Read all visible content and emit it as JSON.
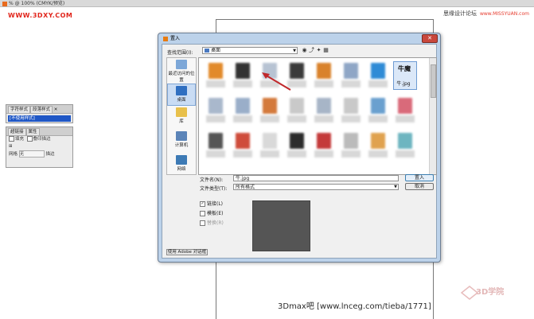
{
  "top_bar": {
    "title": "% @ 100% (CMYK/预览)"
  },
  "watermarks": {
    "left_site": "WWW.3DXY.COM",
    "right_site_cn": "思缘设计论坛",
    "right_site_en": "www.MISSYUAN.com",
    "bottom_text": "3Dmax吧  [www.lnceg.com/tieba/1771]",
    "bottom_logo": "3D学院"
  },
  "panel1": {
    "tabs": [
      "字符样式",
      "段落样式"
    ],
    "selected": "[不使用样式]"
  },
  "panel2": {
    "tabs": [
      "超链接",
      "属性"
    ],
    "row1": [
      "填充",
      "叠印描边"
    ],
    "row2_label": "网格",
    "row2_value": "无",
    "row2_button": "描边"
  },
  "dialog": {
    "title": "置入",
    "close_label": "✕",
    "lookin_label": "查找范围(I):",
    "lookin_value": "桌面",
    "toolbar_icons": [
      "back-icon",
      "up-folder-icon",
      "new-folder-icon",
      "view-menu-icon"
    ],
    "places": [
      {
        "label": "最近访问的位置",
        "icon": "recent-icon"
      },
      {
        "label": "桌面",
        "icon": "desktop-icon"
      },
      {
        "label": "库",
        "icon": "library-icon"
      },
      {
        "label": "计算机",
        "icon": "computer-icon"
      },
      {
        "label": "网络",
        "icon": "network-icon"
      }
    ],
    "selected_file": "牛.jpg",
    "selected_file_thumb": "牛魔",
    "filename_label": "文件名(N):",
    "filename_value": "牛.jpg",
    "filetype_label": "文件类型(T):",
    "filetype_value": "所有格式",
    "open_button": "置入",
    "cancel_button": "取消",
    "options": [
      {
        "label": "链接(L)",
        "checked": true,
        "enabled": true
      },
      {
        "label": "模板(E)",
        "checked": false,
        "enabled": true
      },
      {
        "label": "替换(R)",
        "checked": false,
        "enabled": false
      }
    ],
    "adobe_button": "使用 Adobe 对话框"
  },
  "colors": {
    "accent_red": "#e1251b",
    "dialog_frame": "#bcd2ea",
    "selection": "#dbe8f8"
  }
}
